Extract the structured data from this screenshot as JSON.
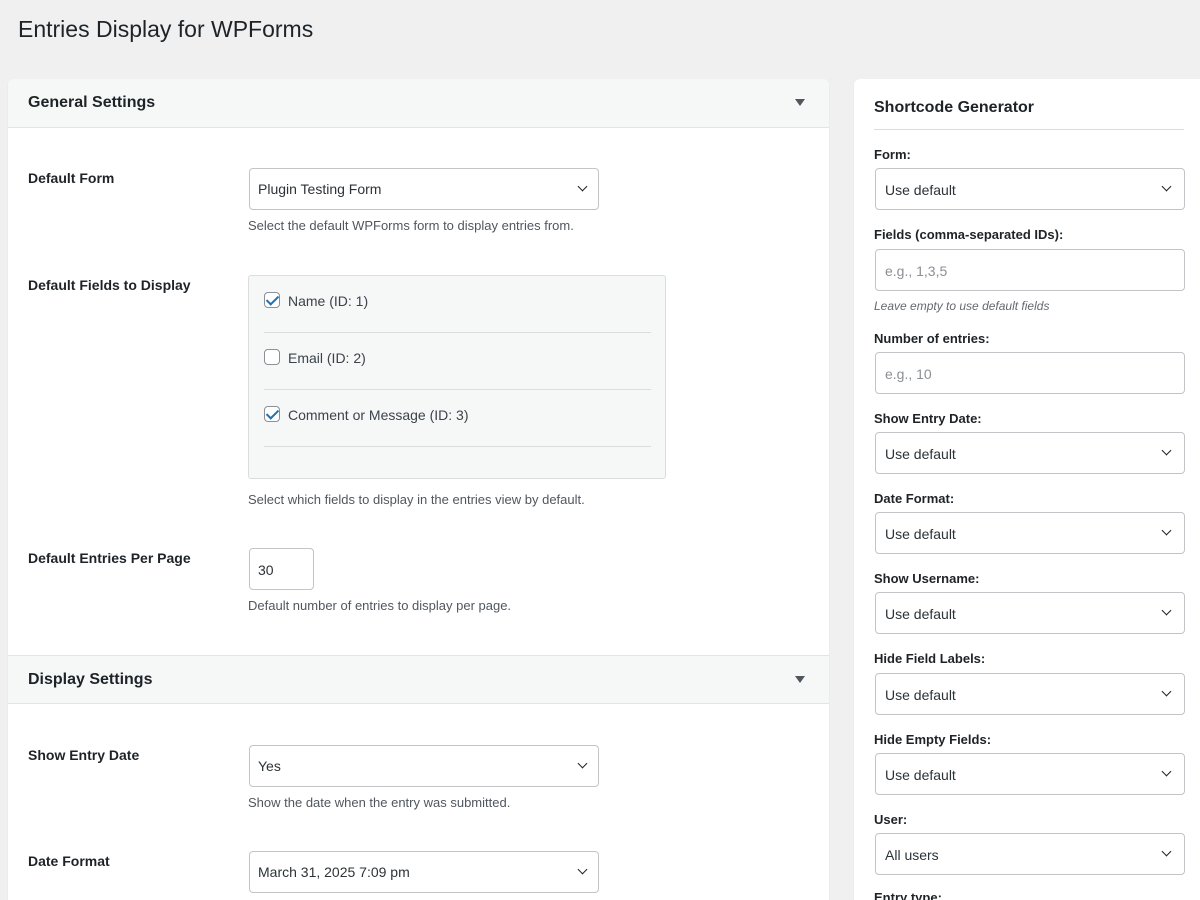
{
  "page": {
    "title": "Entries Display for WPForms"
  },
  "general": {
    "title": "General Settings",
    "default_form": {
      "label": "Default Form",
      "value": "Plugin Testing Form",
      "desc": "Select the default WPForms form to display entries from."
    },
    "fields": {
      "label": "Default Fields to Display",
      "items": [
        {
          "label": "Name (ID: 1)",
          "checked": true
        },
        {
          "label": "Email (ID: 2)",
          "checked": false
        },
        {
          "label": "Comment or Message (ID: 3)",
          "checked": true
        }
      ],
      "desc": "Select which fields to display in the entries view by default."
    },
    "per_page": {
      "label": "Default Entries Per Page",
      "value": "30",
      "desc": "Default number of entries to display per page."
    }
  },
  "display": {
    "title": "Display Settings",
    "show_entry_date": {
      "label": "Show Entry Date",
      "value": "Yes",
      "desc": "Show the date when the entry was submitted."
    },
    "date_format": {
      "label": "Date Format",
      "value": "March 31, 2025 7:09 pm"
    }
  },
  "shortcode": {
    "title": "Shortcode Generator",
    "form": {
      "label": "Form:",
      "value": "Use default"
    },
    "fields": {
      "label": "Fields (comma-separated IDs):",
      "placeholder": "e.g., 1,3,5",
      "hint": "Leave empty to use default fields"
    },
    "number": {
      "label": "Number of entries:",
      "placeholder": "e.g., 10"
    },
    "show_entry_date": {
      "label": "Show Entry Date:",
      "value": "Use default"
    },
    "date_format": {
      "label": "Date Format:",
      "value": "Use default"
    },
    "show_username": {
      "label": "Show Username:",
      "value": "Use default"
    },
    "hide_field_labels": {
      "label": "Hide Field Labels:",
      "value": "Use default"
    },
    "hide_empty_fields": {
      "label": "Hide Empty Fields:",
      "value": "Use default"
    },
    "user": {
      "label": "User:",
      "value": "All users"
    },
    "entry_type": {
      "label": "Entry type:"
    }
  },
  "colors": {
    "accent": "#2271b1",
    "background": "#f0f0f1"
  }
}
